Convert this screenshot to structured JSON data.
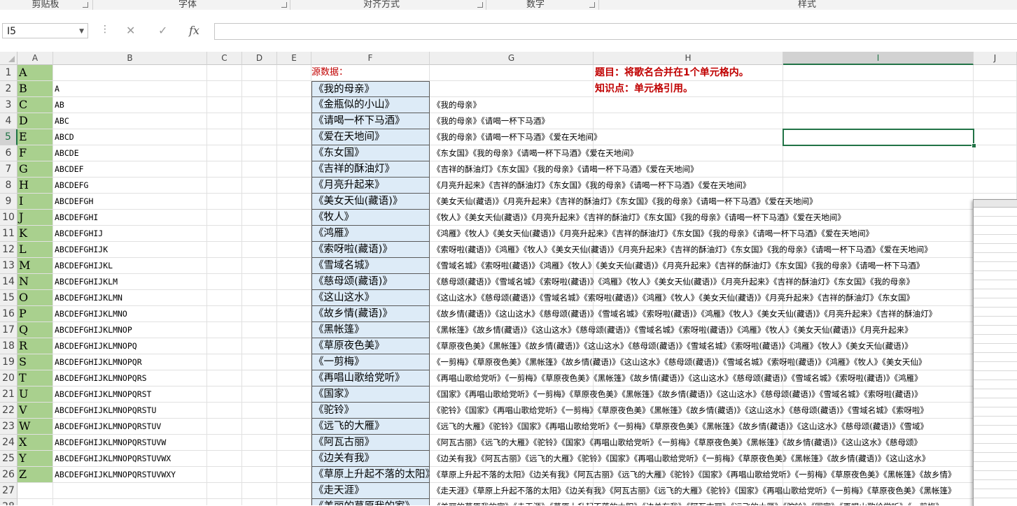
{
  "ribbon": {
    "groups": [
      "剪贴板",
      "字体",
      "对齐方式",
      "数字",
      "样式"
    ]
  },
  "formula_bar": {
    "name_box": "I5",
    "cancel_glyph": "✕",
    "enter_glyph": "✓",
    "fx_label": "fx",
    "formula": ""
  },
  "sheet": {
    "columns": [
      "A",
      "B",
      "C",
      "D",
      "E",
      "F",
      "G",
      "H",
      "I",
      "J"
    ],
    "selected_column": "I",
    "selected_row": "5",
    "row_numbers": [
      "1",
      "2",
      "3",
      "4",
      "5",
      "6",
      "7",
      "8",
      "9",
      "10",
      "11",
      "12",
      "13",
      "14",
      "15",
      "16",
      "17",
      "18",
      "19",
      "20",
      "21",
      "22",
      "23",
      "24",
      "25",
      "26",
      "27",
      "28"
    ],
    "colA": [
      "A",
      "B",
      "C",
      "D",
      "E",
      "F",
      "G",
      "H",
      "I",
      "J",
      "K",
      "L",
      "M",
      "N",
      "O",
      "P",
      "Q",
      "R",
      "S",
      "T",
      "U",
      "V",
      "W",
      "X",
      "Y",
      "Z"
    ],
    "colB": [
      "",
      "A",
      "AB",
      "ABC",
      "ABCD",
      "ABCDE",
      "ABCDEF",
      "ABCDEFG",
      "ABCDEFGH",
      "ABCDEFGHI",
      "ABCDEFGHIJ",
      "ABCDEFGHIJK",
      "ABCDEFGHIJKL",
      "ABCDEFGHIJKLM",
      "ABCDEFGHIJKLMN",
      "ABCDEFGHIJKLMNO",
      "ABCDEFGHIJKLMNOP",
      "ABCDEFGHIJKLMNOPQ",
      "ABCDEFGHIJKLMNOPQR",
      "ABCDEFGHIJKLMNOPQRS",
      "ABCDEFGHIJKLMNOPQRST",
      "ABCDEFGHIJKLMNOPQRSTU",
      "ABCDEFGHIJKLMNOPQRSTUV",
      "ABCDEFGHIJKLMNOPQRSTUVW",
      "ABCDEFGHIJKLMNOPQRSTUVWX",
      "ABCDEFGHIJKLMNOPQRSTUVWXY"
    ],
    "F1": "源数据：",
    "H1": "题目：将歌名合并在1个单元格内。",
    "H2": "知识点：单元格引用。",
    "colF": [
      "《我的母亲》",
      "《金瓶似的小山》",
      "《请喝一杯下马酒》",
      "《爱在天地间》",
      "《东女国》",
      "《吉祥的酥油灯》",
      "《月亮升起来》",
      "《美女天仙(藏语)》",
      "《牧人》",
      "《鸿雁》",
      "《索呀啦(藏语)》",
      "《雪域名城》",
      "《慈母颂(藏语)》",
      "《这山这水》",
      "《故乡情(藏语)》",
      "《黑帐篷》",
      "《草原夜色美》",
      "《一剪梅》",
      "《再唱山歌给党听》",
      "《国家》",
      "《驼铃》",
      "《远飞的大雁》",
      "《阿瓦古丽》",
      "《边关有我》",
      "《草原上升起不落的太阳》",
      "《走天涯》",
      "《美丽的草原我的家》"
    ],
    "colG": [
      "《我的母亲》",
      "《我的母亲》《请喝一杯下马酒》",
      "《我的母亲》《请喝一杯下马酒》《爱在天地间》",
      "《东女国》《我的母亲》《请喝一杯下马酒》《爱在天地间》",
      "《吉祥的酥油灯》《东女国》《我的母亲》《请喝一杯下马酒》《爱在天地间》",
      "《月亮升起来》《吉祥的酥油灯》《东女国》《我的母亲》《请喝一杯下马酒》《爱在天地间》",
      "《美女天仙(藏语)》《月亮升起来》《吉祥的酥油灯》《东女国》《我的母亲》《请喝一杯下马酒》《爱在天地间》",
      "《牧人》《美女天仙(藏语)》《月亮升起来》《吉祥的酥油灯》《东女国》《我的母亲》《请喝一杯下马酒》《爱在天地间》",
      "《鸿雁》《牧人》《美女天仙(藏语)》《月亮升起来》《吉祥的酥油灯》《东女国》《我的母亲》《请喝一杯下马酒》《爱在天地间》",
      "《索呀啦(藏语)》《鸿雁》《牧人》《美女天仙(藏语)》《月亮升起来》《吉祥的酥油灯》《东女国》《我的母亲》《请喝一杯下马酒》《爱在天地间》",
      "《雪域名城》《索呀啦(藏语)》《鸿雁》《牧人》《美女天仙(藏语)》《月亮升起来》《吉祥的酥油灯》《东女国》《我的母亲》《请喝一杯下马酒》",
      "《慈母颂(藏语)》《雪域名城》《索呀啦(藏语)》《鸿雁》《牧人》《美女天仙(藏语)》《月亮升起来》《吉祥的酥油灯》《东女国》《我的母亲》",
      "《这山这水》《慈母颂(藏语)》《雪域名城》《索呀啦(藏语)》《鸿雁》《牧人》《美女天仙(藏语)》《月亮升起来》《吉祥的酥油灯》《东女国》",
      "《故乡情(藏语)》《这山这水》《慈母颂(藏语)》《雪域名城》《索呀啦(藏语)》《鸿雁》《牧人》《美女天仙(藏语)》《月亮升起来》《吉祥的酥油灯》",
      "《黑帐篷》《故乡情(藏语)》《这山这水》《慈母颂(藏语)》《雪域名城》《索呀啦(藏语)》《鸿雁》《牧人》《美女天仙(藏语)》《月亮升起来》",
      "《草原夜色美》《黑帐篷》《故乡情(藏语)》《这山这水》《慈母颂(藏语)》《雪域名城》《索呀啦(藏语)》《鸿雁》《牧人》《美女天仙(藏语)》",
      "《一剪梅》《草原夜色美》《黑帐篷》《故乡情(藏语)》《这山这水》《慈母颂(藏语)》《雪域名城》《索呀啦(藏语)》《鸿雁》《牧人》《美女天仙》",
      "《再唱山歌给党听》《一剪梅》《草原夜色美》《黑帐篷》《故乡情(藏语)》《这山这水》《慈母颂(藏语)》《雪域名城》《索呀啦(藏语)》《鸿雁》",
      "《国家》《再唱山歌给党听》《一剪梅》《草原夜色美》《黑帐篷》《故乡情(藏语)》《这山这水》《慈母颂(藏语)》《雪域名城》《索呀啦(藏语)》",
      "《驼铃》《国家》《再唱山歌给党听》《一剪梅》《草原夜色美》《黑帐篷》《故乡情(藏语)》《这山这水》《慈母颂(藏语)》《雪域名城》《索呀啦》",
      "《远飞的大雁》《驼铃》《国家》《再唱山歌给党听》《一剪梅》《草原夜色美》《黑帐篷》《故乡情(藏语)》《这山这水》《慈母颂(藏语)》《雪域》",
      "《阿瓦古丽》《远飞的大雁》《驼铃》《国家》《再唱山歌给党听》《一剪梅》《草原夜色美》《黑帐篷》《故乡情(藏语)》《这山这水》《慈母颂》",
      "《边关有我》《阿瓦古丽》《远飞的大雁》《驼铃》《国家》《再唱山歌给党听》《一剪梅》《草原夜色美》《黑帐篷》《故乡情(藏语)》《这山这水》",
      "《草原上升起不落的太阳》《边关有我》《阿瓦古丽》《远飞的大雁》《驼铃》《国家》《再唱山歌给党听》《一剪梅》《草原夜色美》《黑帐篷》《故乡情》",
      "《走天涯》《草原上升起不落的太阳》《边关有我》《阿瓦古丽》《远飞的大雁》《驼铃》《国家》《再唱山歌给党听》《一剪梅》《草原夜色美》《黑帐篷》",
      "《美丽的草原我的家》《走天涯》《草原上升起不落的太阳》《边关有我》《阿瓦古丽》《远飞的大雁》《驼铃》《国家》《再唱山歌给党听》《一剪梅》"
    ]
  }
}
